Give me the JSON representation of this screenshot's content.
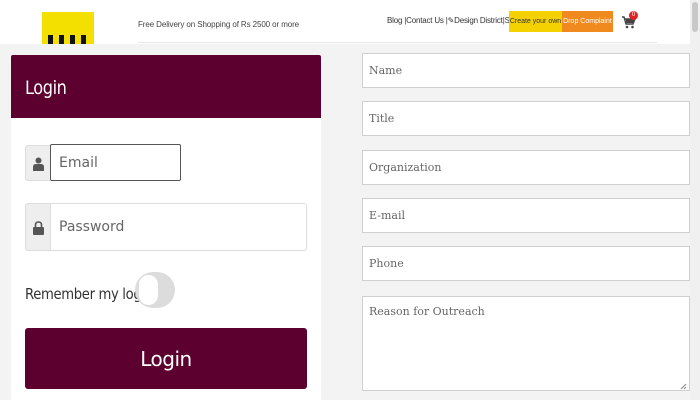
{
  "header": {
    "promo_text": "Free Delivery on Shopping of Rs 2500 or more",
    "nav_blog": "Blog |",
    "nav_contact": "Contact Us |",
    "nav_design": "Design District",
    "nav_signup": "|Signup|",
    "create_button": "Create your own",
    "complaint_button": "Drop Complaint",
    "cart_count": "0",
    "colors": {
      "logo": "#f4e000",
      "create": "#f4d100",
      "complaint": "#f08a1e",
      "badge": "#e32222"
    }
  },
  "login": {
    "title": "Login",
    "email_placeholder": "Email",
    "password_placeholder": "Password",
    "remember_label": "Remember my login",
    "remember_on": false,
    "submit_label": "Login",
    "accent": "#5c0030",
    "icons": {
      "email": "user-icon",
      "password": "lock-icon"
    }
  },
  "contact_form": {
    "name_placeholder": "Name",
    "title_placeholder": "Title",
    "organization_placeholder": "Organization",
    "email_placeholder": "E-mail",
    "phone_placeholder": "Phone",
    "reason_placeholder": "Reason for Outreach"
  }
}
